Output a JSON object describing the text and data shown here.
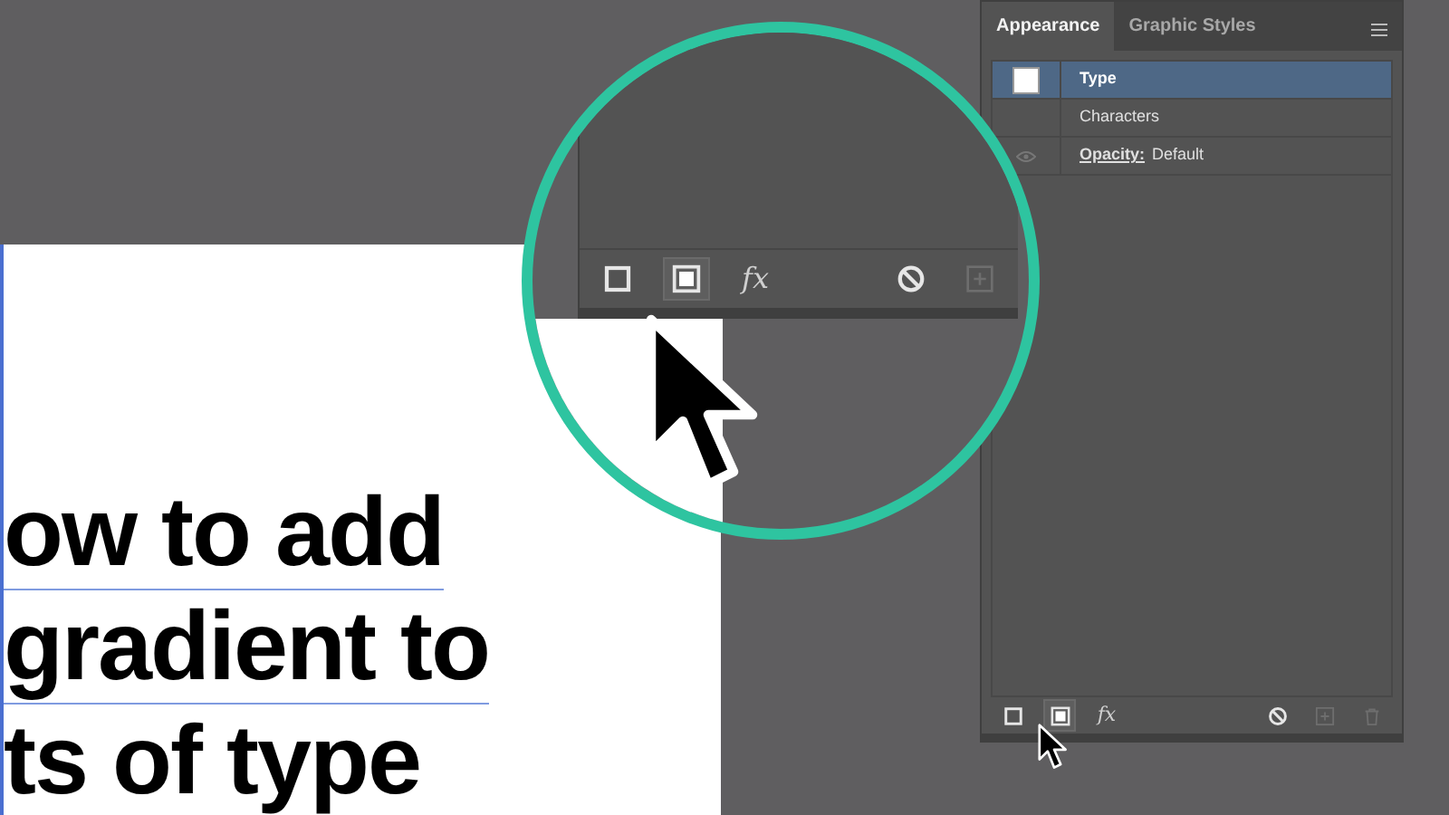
{
  "artboard": {
    "lines": [
      "ow to add",
      "gradient to",
      "ts of type"
    ]
  },
  "magnifier": {
    "toolbar": [
      {
        "kind": "square",
        "selected": false,
        "disabled": false
      },
      {
        "kind": "filled-square",
        "selected": true,
        "disabled": false
      },
      {
        "kind": "fx",
        "label": "fx",
        "selected": false,
        "disabled": false
      },
      {
        "kind": "clear",
        "selected": false,
        "disabled": false
      },
      {
        "kind": "add",
        "selected": false,
        "disabled": true
      }
    ]
  },
  "panel": {
    "tabs": [
      {
        "label": "Appearance",
        "selected": true
      },
      {
        "label": "Graphic Styles",
        "selected": false
      }
    ],
    "rows": [
      {
        "kind": "object",
        "label": "Type",
        "selected": true
      },
      {
        "kind": "item",
        "label": "Characters",
        "selected": false
      },
      {
        "kind": "attribute",
        "label": "Opacity:",
        "value": "Default",
        "selected": false
      }
    ],
    "toolbar": [
      {
        "kind": "square",
        "selected": false,
        "disabled": false
      },
      {
        "kind": "filled-square",
        "selected": true,
        "disabled": false
      },
      {
        "kind": "fx",
        "label": "fx",
        "selected": false,
        "disabled": false
      },
      {
        "kind": "clear",
        "selected": false,
        "disabled": false
      },
      {
        "kind": "add",
        "selected": false,
        "disabled": true
      },
      {
        "kind": "delete",
        "selected": false,
        "disabled": true
      }
    ]
  }
}
